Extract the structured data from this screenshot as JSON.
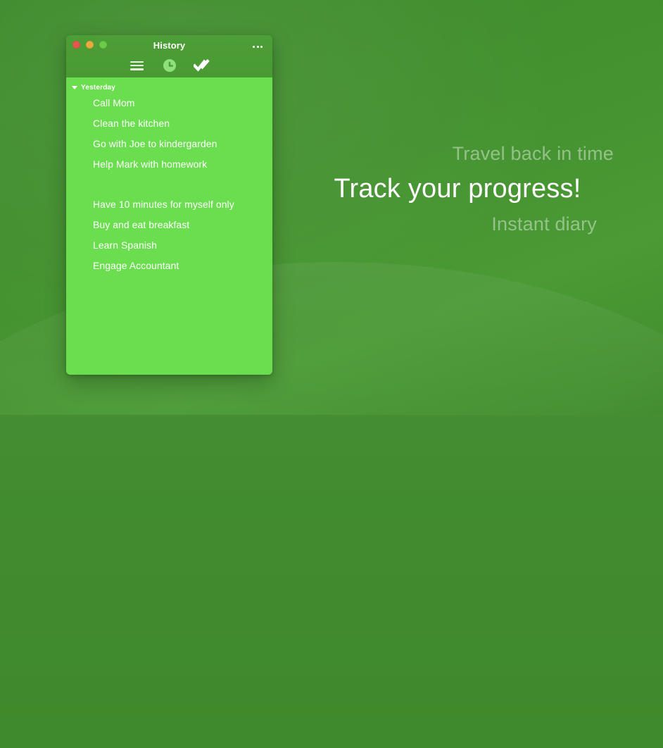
{
  "background": {
    "base_color": "#3f8a2c",
    "gradient_from": "#3c8a2a",
    "gradient_to": "#4a9a35"
  },
  "promo": {
    "top_line": "Travel back in time",
    "main_line": "Track your progress!",
    "bottom_line": "Instant diary",
    "main_color": "#ffffff",
    "muted_color": "rgba(255,255,255,0.42)"
  },
  "window": {
    "title": "History",
    "titlebar_color": "#4a9a33",
    "list_background": "#6bde50",
    "traffic_lights": [
      {
        "name": "close",
        "color": "#e4574d"
      },
      {
        "name": "minimize",
        "color": "#e9a93c"
      },
      {
        "name": "zoom",
        "color": "#6ccb49"
      }
    ],
    "overflow_label": "•••",
    "toolbar": [
      {
        "icon": "hamburger-menu-icon",
        "label": "Menu"
      },
      {
        "icon": "clock-icon",
        "label": "History"
      },
      {
        "icon": "double-check-icon",
        "label": "Done"
      }
    ]
  },
  "history": {
    "group": {
      "label": "Yesterday",
      "expanded": true,
      "caret": "▼"
    },
    "items": [
      {
        "text": "Call Mom",
        "spacer": false
      },
      {
        "text": "Clean the kitchen",
        "spacer": false
      },
      {
        "text": "Go with Joe to kindergarden",
        "spacer": false
      },
      {
        "text": "Help Mark with homework",
        "spacer": false
      },
      {
        "text": "",
        "spacer": true
      },
      {
        "text": "Have 10 minutes for myself only",
        "spacer": false
      },
      {
        "text": "Buy and eat breakfast",
        "spacer": false
      },
      {
        "text": "Learn Spanish",
        "spacer": false
      },
      {
        "text": "Engage Accountant",
        "spacer": false
      }
    ]
  }
}
